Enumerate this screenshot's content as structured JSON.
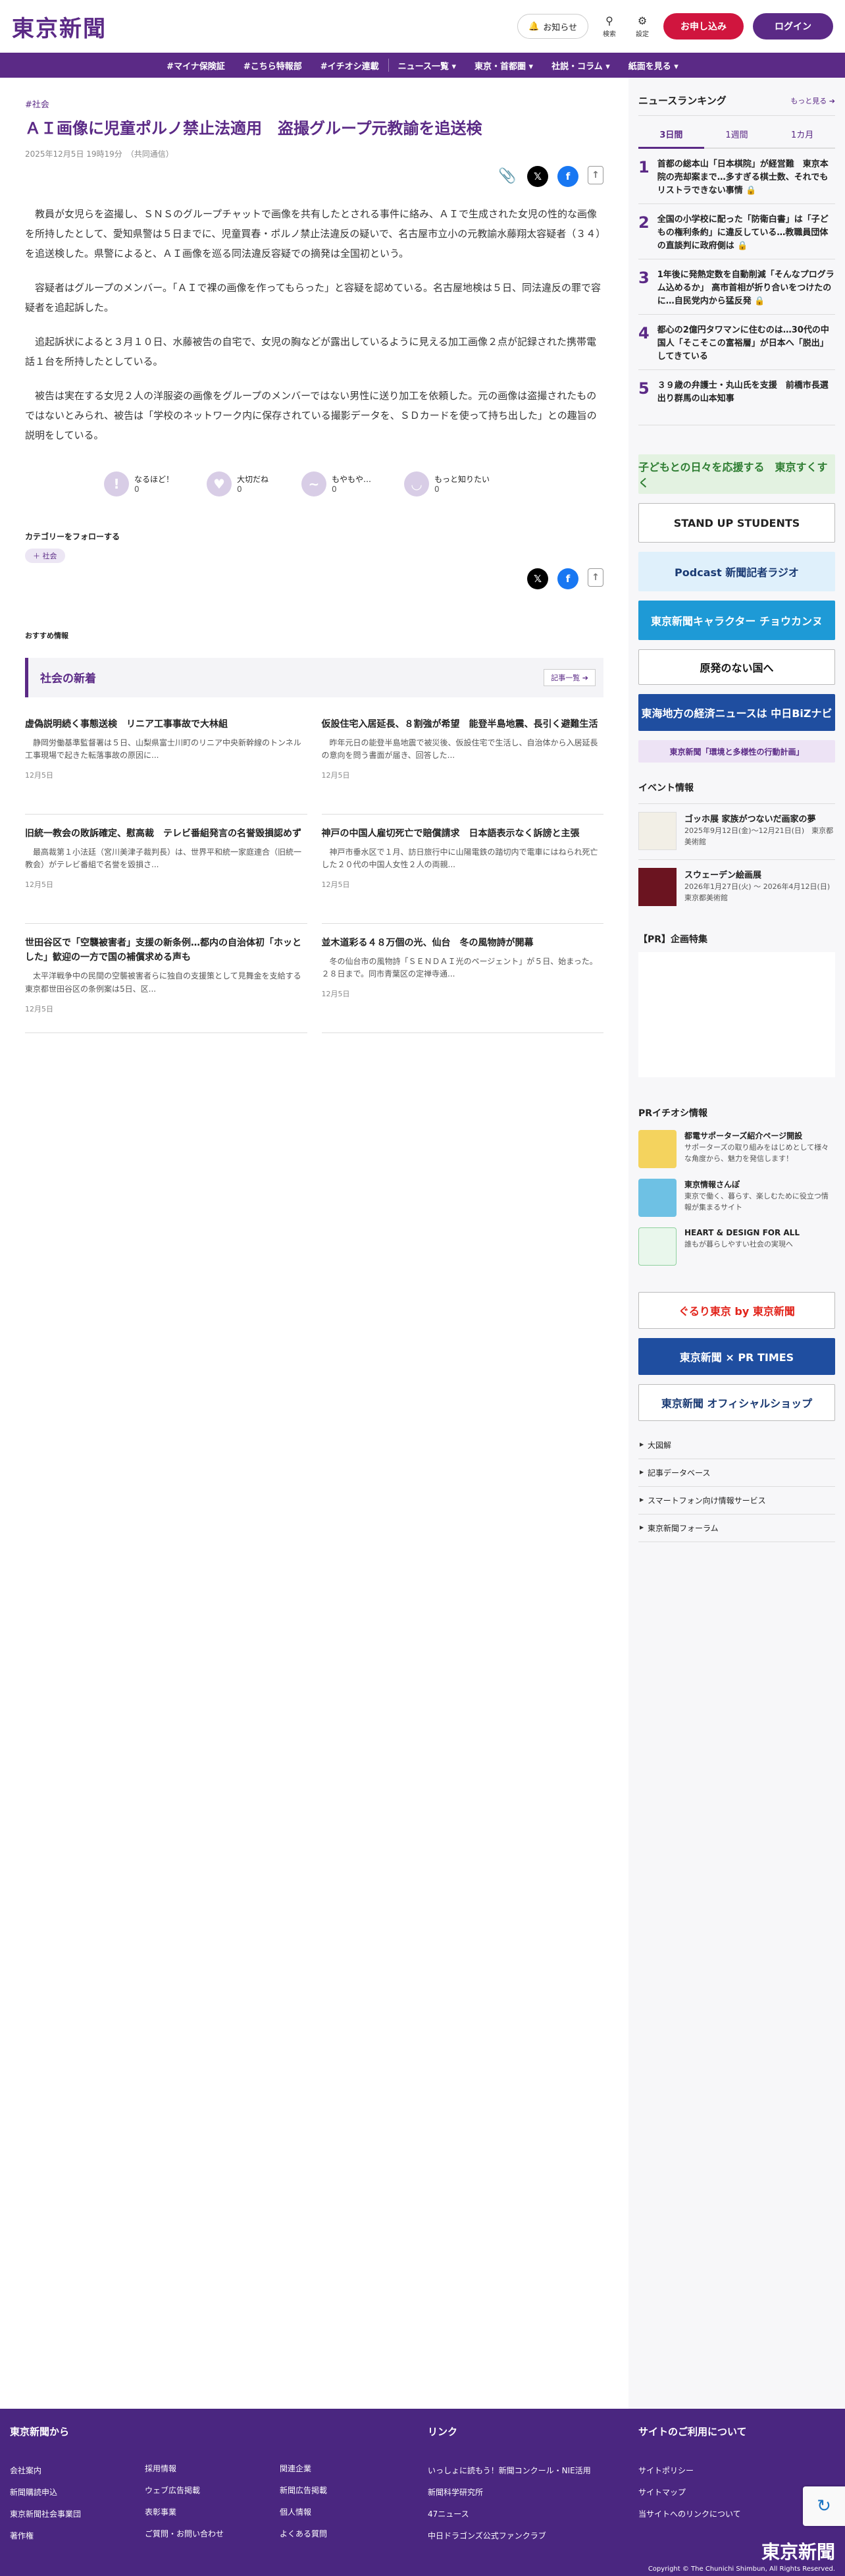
{
  "header": {
    "logo": "東京新聞",
    "notice": "お知らせ",
    "search": "検索",
    "settings": "設定",
    "subscribe": "お申し込み",
    "login": "ログイン"
  },
  "nav": [
    "#マイナ保険証",
    "#こちら特報部",
    "#イチオシ連載",
    "ニュース一覧 ▾",
    "東京・首都圏 ▾",
    "社説・コラム ▾",
    "紙面を見る ▾"
  ],
  "article": {
    "category": "#社会",
    "title": "ＡＩ画像に児童ポルノ禁止法適用　盗撮グループ元教諭を追送検",
    "date": "2025年12月5日 19時19分　（共同通信）",
    "paragraphs": [
      "教員が女児らを盗撮し、ＳＮＳのグループチャットで画像を共有したとされる事件に絡み、ＡＩで生成された女児の性的な画像を所持したとして、愛知県警は５日までに、児童買春・ポルノ禁止法違反の疑いで、名古屋市立小の元教諭水藤翔太容疑者（３４）を追送検した。県警によると、ＡＩ画像を巡る同法違反容疑での摘発は全国初という。",
      "容疑者はグループのメンバー。「ＡＩで裸の画像を作ってもらった」と容疑を認めている。名古屋地検は５日、同法違反の罪で容疑者を追起訴した。",
      "追起訴状によると３月１０日、水藤被告の自宅で、女児の胸などが露出しているように見える加工画像２点が記録された携帯電話１台を所持したとしている。",
      "被告は実在する女児２人の洋服姿の画像をグループのメンバーではない男性に送り加工を依頼した。元の画像は盗撮されたものではないとみられ、被告は「学校のネットワーク内に保存されている撮影データを、ＳＤカードを使って持ち出した」との趣旨の説明をしている。"
    ],
    "reactions": [
      {
        "label": "なるほど！",
        "count": "0"
      },
      {
        "label": "大切だね",
        "count": "0"
      },
      {
        "label": "もやもや…",
        "count": "0"
      },
      {
        "label": "もっと知りたい",
        "count": "0"
      }
    ],
    "follow_label": "カテゴリーをフォローする",
    "follow_chip": "＋ 社会",
    "recommend_label": "おすすめ情報"
  },
  "section": {
    "title": "社会の新着",
    "more": "記事一覧 ➔",
    "items": [
      {
        "title": "虚偽説明続く事態送検　リニア工事事故で大林組",
        "summary": "　静岡労働基準監督署は５日、山梨県富士川町のリニア中央新幹線のトンネル工事現場で起きた転落事故の原因に...",
        "date": "12月5日"
      },
      {
        "title": "仮設住宅入居延長、８割強が希望　能登半島地震、長引く避難生活",
        "summary": "　昨年元日の能登半島地震で被災後、仮設住宅で生活し、自治体から入居延長の意向を問う書面が届き、回答した...",
        "date": "12月5日"
      },
      {
        "title": "旧統一教会の敗訴確定、慰高裁　テレビ番組発言の名誉毀損認めず",
        "summary": "　最高裁第１小法廷（宮川美津子裁判長）は、世界平和統一家庭連合（旧統一教会）がテレビ番組で名誉を毀損さ...",
        "date": "12月5日"
      },
      {
        "title": "神戸の中国人雇切死亡で賠償請求　日本語表示なく訴謗と主張",
        "summary": "　神戸市垂水区で１月、訪日旅行中に山陽電鉄の踏切内で電車にはねられ死亡した２０代の中国人女性２人の両親...",
        "date": "12月5日"
      },
      {
        "title": "世田谷区で「空襲被害者」支援の新条例…都内の自治体初「ホッとした」歓迎の一方で国の補償求める声も",
        "summary": "　太平洋戦争中の民間の空襲被害者らに独自の支援策として見舞金を支給する東京都世田谷区の条例案は5日、区...",
        "date": "12月5日"
      },
      {
        "title": "並木道彩る４８万個の光、仙台　冬の風物詩が開幕",
        "summary": "　冬の仙台市の風物詩「ＳＥＮＤＡＩ光のページェント」が５日、始まった。２８日まで。同市青葉区の定禅寺通...",
        "date": "12月5日"
      }
    ]
  },
  "ranking": {
    "title": "ニュースランキング",
    "more": "もっと見る ➔",
    "tabs": [
      "3日間",
      "1週間",
      "1カ月"
    ],
    "items": [
      {
        "n": "1",
        "text": "首都の総本山「日本棋院」が経営難　東京本院の売却案まで…多すぎる棋士数、それでもリストラできない事情 🔒"
      },
      {
        "n": "2",
        "text": "全国の小学校に配った「防衛白書」は「子どもの権利条約」に違反している…教職員団体の直談判に政府側は 🔒"
      },
      {
        "n": "3",
        "text": "1年後に発熱定数を自動削減「そんなプログラム込めるか」 高市首相が折り合いをつけたのに…自民党内から猛反発 🔒"
      },
      {
        "n": "4",
        "text": "都心の2億円タワマンに住むのは…30代の中国人「そこそこの富裕層」が日本へ「脱出」してきている"
      },
      {
        "n": "5",
        "text": "３９歳の弁護士・丸山氏を支援　前橋市長選出り群馬の山本知事"
      }
    ]
  },
  "banners": [
    {
      "label": "子どもとの日々を応援する　東京すくすく",
      "bg": "#e3f2e1",
      "fg": "#2e7d32",
      "h": 60
    },
    {
      "label": "STAND UP STUDENTS",
      "bg": "#ffffff",
      "fg": "#222222",
      "h": 60
    },
    {
      "label": "Podcast 新聞記者ラジオ",
      "bg": "#dff0fb",
      "fg": "#1a3a73",
      "h": 60
    },
    {
      "label": "東京新聞キャラクター チョウカンヌ",
      "bg": "#1e9ad6",
      "fg": "#ffffff",
      "h": 60
    },
    {
      "label": "原発のない国へ",
      "bg": "#ffffff",
      "fg": "#111111",
      "h": 54
    },
    {
      "label": "東海地方の経済ニュースは 中日BiZナビ",
      "bg": "#1f4ea0",
      "fg": "#ffffff",
      "h": 56
    },
    {
      "label": "東京新聞「環境と多様性の行動計画」",
      "bg": "#ede3f5",
      "fg": "#5b2a86",
      "h": 34
    }
  ],
  "events": {
    "title": "イベント情報",
    "items": [
      {
        "title": "ゴッホ展 家族がつないだ画家の夢",
        "date": "2025年9月12日(金)～12月21日(日)　東京都美術館"
      },
      {
        "title": "スウェーデン絵画展",
        "date": "2026年1月27日(火) ～ 2026年4月12日(日)　東京都美術館"
      }
    ]
  },
  "pr_feature": {
    "title": "【PR】企画特集"
  },
  "pr_info": {
    "title": "PRイチオシ情報",
    "items": [
      {
        "title": "都電サポーターズ紹介ページ開設",
        "desc": "サポーターズの取り組みをはじめとして様々な角度から、魅力を発信します！",
        "color": "#f4d35e"
      },
      {
        "title": "東京情報さんぽ",
        "desc": "東京で働く、暮らす、楽しむために役立つ情報が集まるサイト",
        "color": "#6ec1e4"
      },
      {
        "title": "HEART & DESIGN FOR ALL",
        "desc": "誰もが暮らしやすい社会の実現へ",
        "color": "#8fd19e"
      }
    ]
  },
  "banners2": [
    {
      "label": "ぐるり東京 by 東京新聞",
      "bg": "#ffffff",
      "fg": "#e2231a",
      "h": 56
    },
    {
      "label": "東京新聞 × PR TIMES",
      "bg": "#1f4ea0",
      "fg": "#ffffff",
      "h": 56
    },
    {
      "label": "東京新聞 オフィシャルショップ",
      "bg": "#ffffff",
      "fg": "#1a3a73",
      "h": 56
    }
  ],
  "side_links": [
    "大図解",
    "記事データベース",
    "スマートフォン向け情報サービス",
    "東京新聞フォーラム"
  ],
  "footer": {
    "cols": [
      {
        "head": "東京新聞から",
        "links": [
          "会社案内",
          "新聞購読申込",
          "東京新聞社会事業団",
          "著作権"
        ]
      },
      {
        "head": "",
        "links": [
          "採用情報",
          "ウェブ広告掲載",
          "表彰事業",
          "ご質問・お問い合わせ"
        ]
      },
      {
        "head": "",
        "links": [
          "関連企業",
          "新聞広告掲載",
          "個人情報",
          "よくある質問"
        ]
      },
      {
        "head": "リンク",
        "links": [
          "いっしょに読もう！新聞コンクール・NIE活用",
          "新聞科学研究所",
          "47ニュース",
          "中日ドラゴンズ公式ファンクラブ"
        ]
      },
      {
        "head": "サイトのご利用について",
        "links": [
          "サイトポリシー",
          "サイトマップ",
          "当サイトへのリンクについて"
        ]
      }
    ],
    "logo": "東京新聞",
    "copyright": "Copyright © The Chunichi Shimbun, All Rights Reserved."
  }
}
